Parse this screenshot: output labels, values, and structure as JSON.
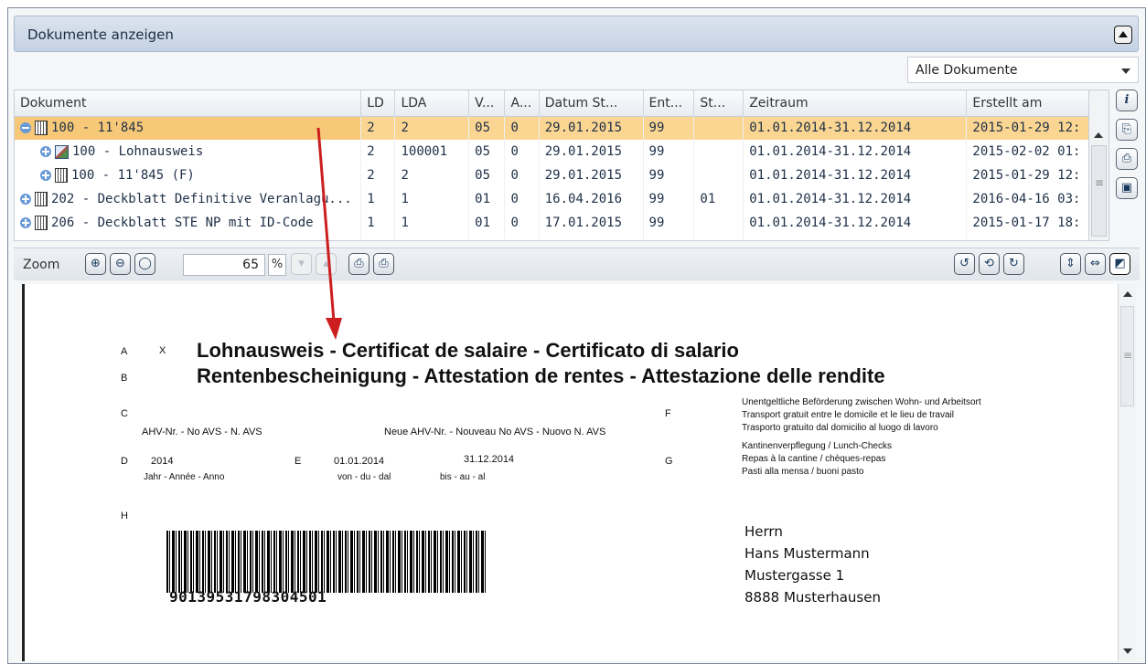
{
  "panel": {
    "title": "Dokumente anzeigen"
  },
  "filter": {
    "selected": "Alle Dokumente"
  },
  "grid": {
    "columns": [
      "Dokument",
      "LD",
      "LDA",
      "V...",
      "A...",
      "Datum St...",
      "Ent...",
      "St...",
      "Zeitraum",
      "Erstellt am"
    ],
    "rows": [
      {
        "doc": "100 - 11'845",
        "ld": "2",
        "lda": "2",
        "v": "05",
        "a": "0",
        "datum": "29.01.2015",
        "ent": "99",
        "st": "",
        "zeitraum": "01.01.2014-31.12.2014",
        "erstellt": "2015-01-29 12:"
      },
      {
        "doc": "100 - Lohnausweis",
        "ld": "2",
        "lda": "100001",
        "v": "05",
        "a": "0",
        "datum": "29.01.2015",
        "ent": "99",
        "st": "",
        "zeitraum": "01.01.2014-31.12.2014",
        "erstellt": "2015-02-02 01:"
      },
      {
        "doc": "100 - 11'845  (F)",
        "ld": "2",
        "lda": "2",
        "v": "05",
        "a": "0",
        "datum": "29.01.2015",
        "ent": "99",
        "st": "",
        "zeitraum": "01.01.2014-31.12.2014",
        "erstellt": "2015-01-29 12:"
      },
      {
        "doc": "202 - Deckblatt Definitive Veranlagu...",
        "ld": "1",
        "lda": "1",
        "v": "01",
        "a": "0",
        "datum": "16.04.2016",
        "ent": "99",
        "st": "01",
        "zeitraum": "01.01.2014-31.12.2014",
        "erstellt": "2016-04-16 03:"
      },
      {
        "doc": "206 - Deckblatt STE NP mit ID-Code",
        "ld": "1",
        "lda": "1",
        "v": "01",
        "a": "0",
        "datum": "17.01.2015",
        "ent": "99",
        "st": "",
        "zeitraum": "01.01.2014-31.12.2014",
        "erstellt": "2015-01-17 18:"
      }
    ]
  },
  "viewer": {
    "zoom_label": "Zoom",
    "zoom_value": "65",
    "zoom_unit": "%"
  },
  "document": {
    "a": "A",
    "x": "X",
    "title1": "Lohnausweis - Certificat de salaire - Certificato di salario",
    "b": "B",
    "title2": "Rentenbescheinigung - Attestation de rentes - Attestazione delle rendite",
    "c": "C",
    "ahv": "AHV-Nr. - No AVS - N. AVS",
    "neue_ahv": "Neue AHV-Nr. - Nouveau No AVS - Nuovo N. AVS",
    "f": "F",
    "f_line1": "Unentgeltliche Beförderung zwischen Wohn- und Arbeitsort",
    "f_line2": "Transport gratuit entre le domicile et le lieu de travail",
    "f_line3": "Trasporto gratuito dal domicilio al luogo di lavoro",
    "d": "D",
    "year": "2014",
    "year_label": "Jahr - Année - Anno",
    "e": "E",
    "from": "01.01.2014",
    "from_label": "von - du - dal",
    "to": "31.12.2014",
    "to_label": "bis - au - al",
    "g": "G",
    "g_line1": "Kantinenverpflegung / Lunch-Checks",
    "g_line2": "Repas à la cantine / chèques-repas",
    "g_line3": "Pasti alla mensa / buoni pasto",
    "h": "H",
    "barcode_number": "90139531798304501",
    "address": [
      "Herrn",
      "Hans Mustermann",
      "Mustergasse 1",
      "8888 Musterhausen"
    ]
  },
  "annotation_color": "#cc1e1e"
}
